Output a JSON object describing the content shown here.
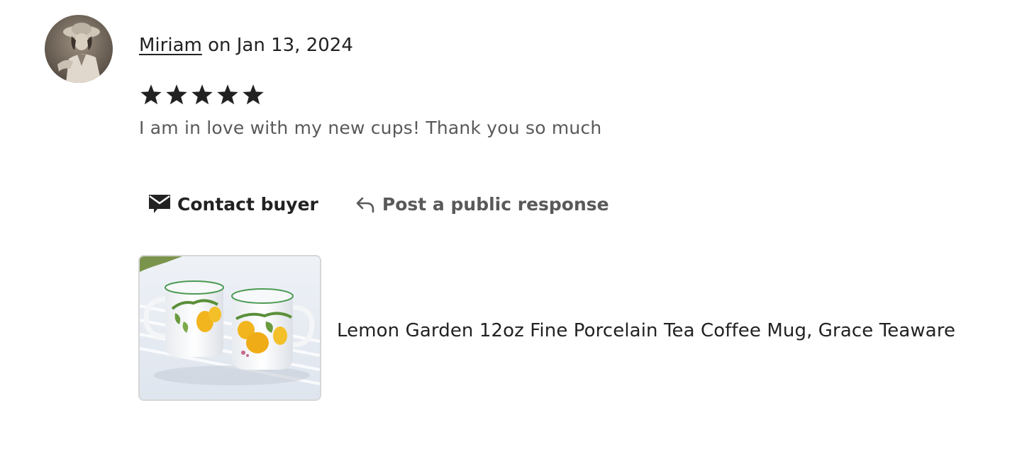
{
  "review": {
    "reviewer_name": "Miriam",
    "date_text": " on Jan 13, 2024",
    "rating": 5,
    "rating_max": 5,
    "text": "I am in love with my new cups! Thank you so much"
  },
  "actions": {
    "contact_label": "Contact buyer",
    "respond_label": "Post a public response"
  },
  "product": {
    "title": "Lemon Garden 12oz Fine Porcelain Tea Coffee Mug, Grace Teaware"
  },
  "icons": {
    "contact": "envelope-icon",
    "respond": "reply-arrow-icon",
    "star": "star-icon"
  },
  "colors": {
    "text_primary": "#222222",
    "text_secondary": "#595959",
    "border": "#d6d6d6"
  }
}
